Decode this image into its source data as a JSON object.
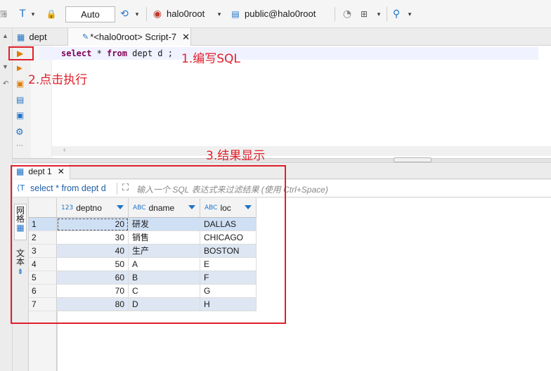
{
  "toolbar": {
    "mode_label": "Auto",
    "connection": "halo0root",
    "database": "public@halo0root"
  },
  "tabs": [
    {
      "label": "dept"
    },
    {
      "label": "*<halo0root> Script-7"
    }
  ],
  "editor": {
    "sql_keyword_select": "select",
    "sql_star": " * ",
    "sql_keyword_from": "from",
    "sql_rest": " dept d ;"
  },
  "results": {
    "tab_label": "dept 1",
    "filter_query": "select * from dept d",
    "filter_placeholder": "输入一个 SQL 表达式来过滤结果 (使用 Ctrl+Space)",
    "side_tab_grid": "网格",
    "side_tab_text": "文本",
    "columns": [
      {
        "type": "123",
        "name": "deptno"
      },
      {
        "type": "ABC",
        "name": "dname"
      },
      {
        "type": "ABC",
        "name": "loc"
      }
    ],
    "rows": [
      {
        "n": "1",
        "deptno": "20",
        "dname": "研发",
        "loc": "DALLAS"
      },
      {
        "n": "2",
        "deptno": "30",
        "dname": "销售",
        "loc": "CHICAGO"
      },
      {
        "n": "3",
        "deptno": "40",
        "dname": "生产",
        "loc": "BOSTON"
      },
      {
        "n": "4",
        "deptno": "50",
        "dname": "A",
        "loc": "E"
      },
      {
        "n": "5",
        "deptno": "60",
        "dname": "B",
        "loc": "F"
      },
      {
        "n": "6",
        "deptno": "70",
        "dname": "C",
        "loc": "G"
      },
      {
        "n": "7",
        "deptno": "80",
        "dname": "D",
        "loc": "H"
      }
    ]
  },
  "annotations": {
    "step1": "1.编写SQL",
    "step2": "2.点击执行",
    "step3": "3.结果显示"
  },
  "colors": {
    "annotation_red": "#e0202a",
    "accent_blue": "#1e73c8",
    "selected_row": "#cfe0f5"
  }
}
